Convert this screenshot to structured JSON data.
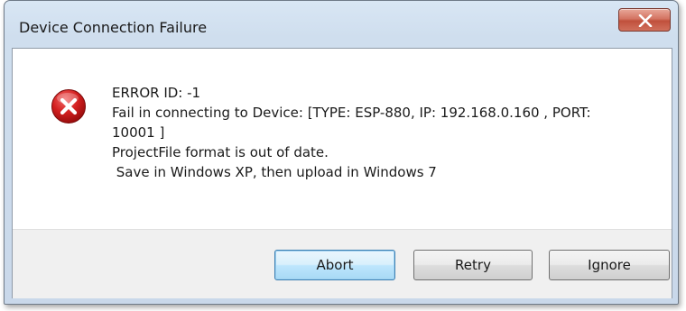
{
  "window": {
    "title": "Device Connection Failure",
    "close_icon": "close-icon"
  },
  "message": {
    "icon": "error-icon",
    "lines": [
      "ERROR ID: -1",
      "Fail in connecting to Device: [TYPE: ESP-880, IP: 192.168.0.160 , PORT:",
      "10001 ]",
      "ProjectFile format is out of date.",
      " Save in Windows XP, then upload in Windows 7"
    ]
  },
  "buttons": {
    "abort": "Abort",
    "retry": "Retry",
    "ignore": "Ignore"
  },
  "colors": {
    "error_red": "#c8102e",
    "default_button_border": "#3c7fb1",
    "frame": "#cfdeee"
  }
}
